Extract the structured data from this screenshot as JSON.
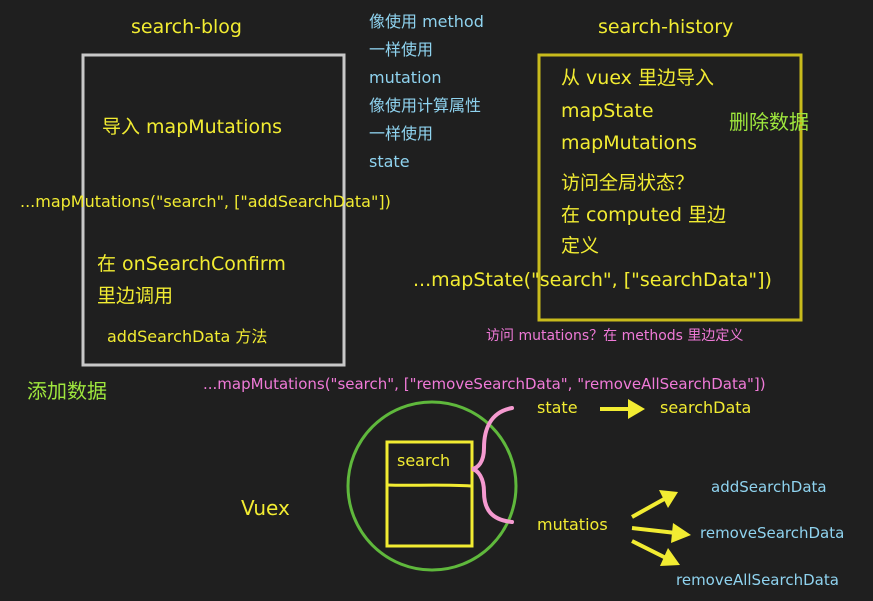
{
  "left": {
    "title": "search-blog",
    "import_text": "导入 mapMutations",
    "mapmutations_code": "...mapMutations(\"search\", [\"addSearchData\"])",
    "call_line1": "在 onSearchConfirm",
    "call_line2": "里边调用",
    "method_text": "addSearchData 方法",
    "caption": "添加数据"
  },
  "middle": {
    "lines": [
      "像使用 method",
      "一样使用",
      "mutation",
      "像使用计算属性",
      "一样使用",
      "state"
    ]
  },
  "right": {
    "title": "search-history",
    "import_lines": [
      "从 vuex 里边导入",
      "mapState",
      "mapMutations"
    ],
    "caption": "删除数据",
    "state_question": "访问全局状态？",
    "computed_line1": "在 computed 里边",
    "computed_line2": "定义",
    "mapstate_code": "...mapState(\"search\", [\"searchData\"])",
    "mutations_question": "访问 mutations？在 methods 里边定义",
    "remove_code": "...mapMutations(\"search\", [\"removeSearchData\", \"removeAllSearchData\"])"
  },
  "vuex": {
    "label": "Vuex",
    "module": "search",
    "state_label": "state",
    "state_target": "searchData",
    "mutations_label": "mutatios",
    "mutations": [
      "addSearchData",
      "removeSearchData",
      "removeAllSearchData"
    ]
  },
  "colors": {
    "background": "#1f1f1f",
    "yellow": "#f2ec32",
    "cyan": "#8fd3ef",
    "pink": "#f07ad8",
    "green": "#9ee63d",
    "gray_box": "#c8c8c8",
    "olive_box": "#c8bb1c",
    "circle": "#5fb83c",
    "brace": "#f59ad0"
  }
}
